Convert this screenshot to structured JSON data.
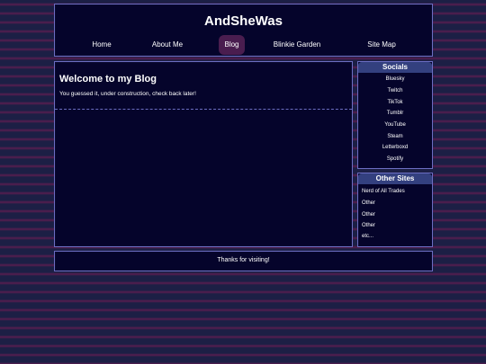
{
  "header": {
    "title": "AndSheWas"
  },
  "nav": {
    "items": [
      {
        "label": "Home",
        "active": false
      },
      {
        "label": "About Me",
        "active": false
      },
      {
        "label": "Blog",
        "active": true
      },
      {
        "label": "Blinkie Garden",
        "active": false
      },
      {
        "label": "Site Map",
        "active": false
      }
    ]
  },
  "main": {
    "title": "Welcome to my Blog",
    "text": "You guessed it, under construction, check back later!"
  },
  "sidebar": {
    "socials": {
      "heading": "Socials",
      "links": [
        "Bluesky",
        "Twitch",
        "TikTok",
        "Tumblr",
        "YouTube",
        "Steam",
        "Letterboxd",
        "Spotify"
      ]
    },
    "other_sites": {
      "heading": "Other Sites",
      "links": [
        "Nerd of All Trades",
        "Other",
        "Other",
        "Other",
        "etc..."
      ]
    }
  },
  "footer": {
    "text": "Thanks for visiting!"
  },
  "colors": {
    "panel_background": "#05042b",
    "panel_border": "#6b6dc2",
    "active_nav": "#4a1d4f",
    "sidebar_heading": "#33407f"
  }
}
